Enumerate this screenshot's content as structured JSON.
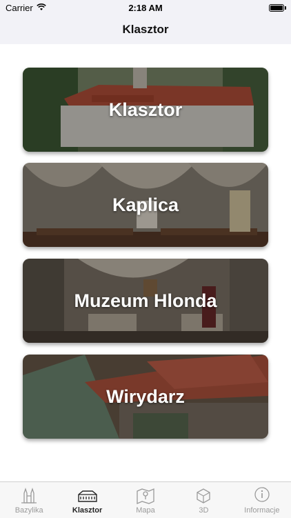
{
  "status_bar": {
    "carrier": "Carrier",
    "time": "2:18 AM"
  },
  "nav": {
    "title": "Klasztor"
  },
  "cards": [
    {
      "label": "Klasztor"
    },
    {
      "label": "Kaplica"
    },
    {
      "label": "Muzeum Hlonda"
    },
    {
      "label": "Wirydarz"
    }
  ],
  "tabs": [
    {
      "label": "Bazylika",
      "icon": "basilica-icon",
      "active": false
    },
    {
      "label": "Klasztor",
      "icon": "monastery-icon",
      "active": true
    },
    {
      "label": "Mapa",
      "icon": "map-icon",
      "active": false
    },
    {
      "label": "3D",
      "icon": "3d-icon",
      "active": false
    },
    {
      "label": "Informacje",
      "icon": "info-icon",
      "active": false
    }
  ],
  "colors": {
    "accent": "#222222",
    "inactive": "#9a9a9a",
    "tab_bg": "#f7f7f7"
  }
}
